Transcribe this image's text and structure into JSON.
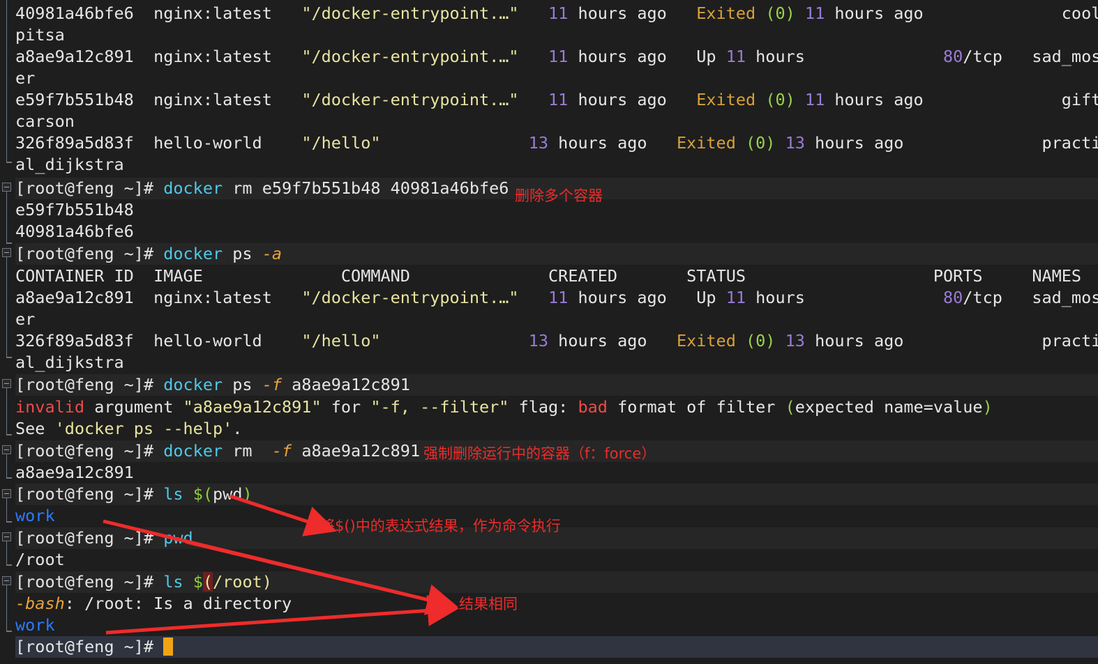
{
  "terminal": {
    "prompt": "[root@feng ~]#",
    "cursor_glyph": "",
    "wrap_marker": "⏎"
  },
  "colors": {
    "background": "#1e1e1e",
    "command_line_bg": "#262626",
    "active_line_bg": "#2f3440",
    "foreground": "#e6e6e6",
    "hash": "#ff4d8d",
    "command": "#4ec9e8",
    "flag": "#e8a33d",
    "number": "#9a7bd6",
    "string": "#e8e4a0",
    "error": "#f04a4a",
    "green": "#9ad14b",
    "exited": "#d9a13b",
    "dir_blue": "#2a7bff",
    "wrap_marker": "#2f9ece",
    "cursor": "#f0a415",
    "annotation": "#ef2b2b"
  },
  "ps_table": {
    "headers": [
      "CONTAINER ID",
      "IMAGE",
      "COMMAND",
      "CREATED",
      "STATUS",
      "PORTS",
      "NAMES"
    ],
    "rows_top": [
      {
        "id": "40981a46bfe6",
        "image": "nginx:latest",
        "command": "\"/docker-entrypoint.…\"",
        "created_num": "11",
        "created_rest": " hours ago",
        "status_state": "Exited",
        "status_code": "(0)",
        "status_num": "11",
        "status_rest": " hours ago",
        "ports": "",
        "name": "cool_ka",
        "name_wrap": "pitsa"
      },
      {
        "id": "a8ae9a12c891",
        "image": "nginx:latest",
        "command": "\"/docker-entrypoint.…\"",
        "created_num": "11",
        "created_rest": " hours ago",
        "status_state": "Up",
        "status_code": "",
        "status_num": "11",
        "status_rest": " hours",
        "ports": "80/tcp",
        "ports_num": "80",
        "ports_rest": "/tcp",
        "name": "sad_mos",
        "name_wrap": "er"
      },
      {
        "id": "e59f7b551b48",
        "image": "nginx:latest",
        "command": "\"/docker-entrypoint.…\"",
        "created_num": "11",
        "created_rest": " hours ago",
        "status_state": "Exited",
        "status_code": "(0)",
        "status_num": "11",
        "status_rest": " hours ago",
        "ports": "",
        "name": "gifted_",
        "name_wrap": "carson"
      },
      {
        "id": "326f89a5d83f",
        "image": "hello-world",
        "command": "\"/hello\"",
        "created_num": "13",
        "created_rest": " hours ago",
        "status_state": "Exited",
        "status_code": "(0)",
        "status_num": "13",
        "status_rest": " hours ago",
        "ports": "",
        "name": "practic",
        "name_wrap": "al_dijkstra"
      }
    ],
    "rows_second": [
      {
        "id": "a8ae9a12c891",
        "image": "nginx:latest",
        "command": "\"/docker-entrypoint.…\"",
        "created_num": "11",
        "created_rest": " hours ago",
        "status_state": "Up",
        "status_code": "",
        "status_num": "11",
        "status_rest": " hours",
        "ports_num": "80",
        "ports_rest": "/tcp",
        "name": "sad_mos",
        "name_wrap": "er"
      },
      {
        "id": "326f89a5d83f",
        "image": "hello-world",
        "command": "\"/hello\"",
        "created_num": "13",
        "created_rest": " hours ago",
        "status_state": "Exited",
        "status_code": "(0)",
        "status_num": "13",
        "status_rest": " hours ago",
        "ports_num": "",
        "ports_rest": "",
        "name": "practic",
        "name_wrap": "al_dijkstra"
      }
    ]
  },
  "commands": {
    "rm_multi": {
      "cmd": "docker",
      "args": " rm e59f7b551b48 40981a46bfe6"
    },
    "ps_a": {
      "cmd": "docker",
      "sub": " ps ",
      "flag": "-a"
    },
    "ps_f": {
      "cmd": "docker",
      "sub": " ps ",
      "flag": "-f",
      "arg": " a8ae9a12c891"
    },
    "rm_f": {
      "cmd": "docker",
      "sub": " rm  ",
      "flag": "-f",
      "arg": " a8ae9a12c891"
    },
    "ls_pwd": {
      "cmd": "ls",
      "expr_dollar": "$(",
      "expr_body": "pwd",
      "expr_close": ")"
    },
    "pwd": {
      "cmd": "pwd"
    },
    "ls_root": {
      "cmd": "ls",
      "expr_dollar": "$",
      "bad_paren": "(",
      "expr_body": "/root)"
    }
  },
  "outputs": {
    "rm_out_1": "e59f7b551b48",
    "rm_out_2": "40981a46bfe6",
    "rm_f_out": "a8ae9a12c891",
    "work_1": "work",
    "pwd_out": "/root",
    "work_2": "work",
    "error_invalid": "invalid",
    "error_mid1": " argument ",
    "error_arg": "\"a8ae9a12c891\"",
    "error_mid2": " for ",
    "error_flag": "\"-f, --filter\"",
    "error_mid3": " flag: ",
    "error_bad": "bad",
    "error_mid4": " format of filter ",
    "error_paren_open": "(",
    "error_expected": "expected name=value",
    "error_paren_close": ")",
    "see_prefix": "See ",
    "see_quote": "'docker ps --help'",
    "see_dot": ".",
    "bash_name": "-bash",
    "bash_rest": ": /root: Is a directory"
  },
  "annotations": [
    {
      "id": "anno-rm-multi",
      "text": "删除多个容器"
    },
    {
      "id": "anno-force-rm",
      "text": "强制删除运行中的容器（f：force）"
    },
    {
      "id": "anno-subshell",
      "text": "将$()中的表达式结果，作为命令执行"
    },
    {
      "id": "anno-same-result",
      "text": "结果相同"
    }
  ]
}
